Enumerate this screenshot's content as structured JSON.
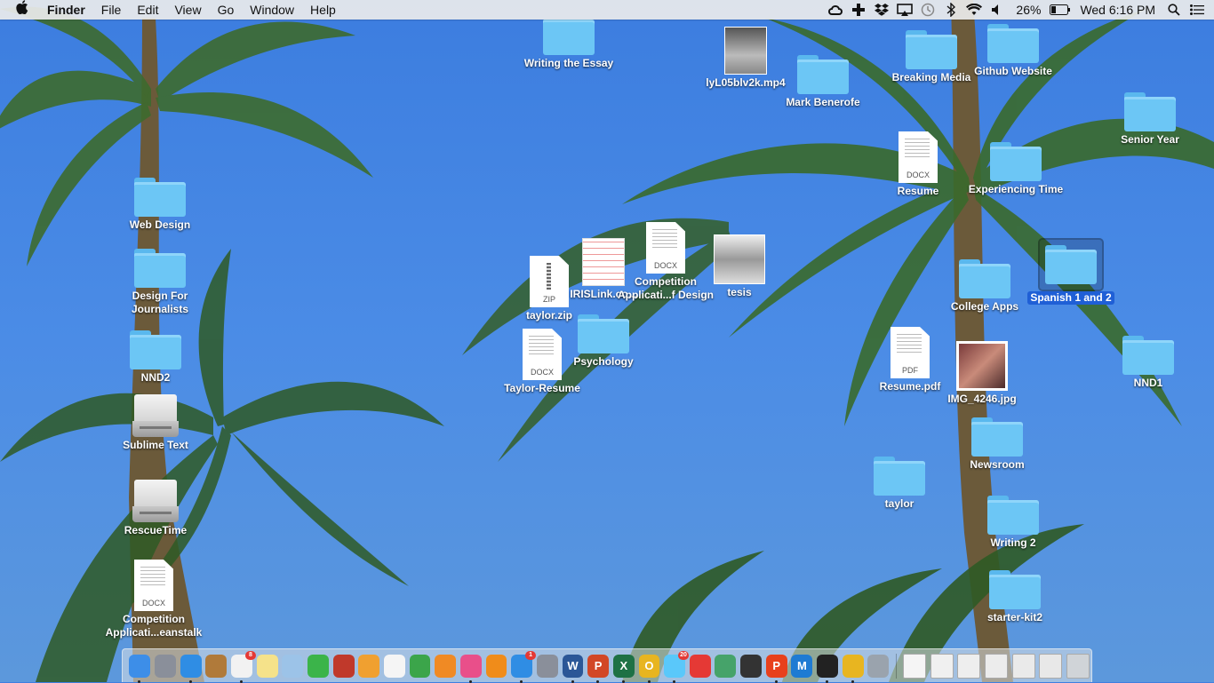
{
  "menubar": {
    "app_name": "Finder",
    "menus": [
      "File",
      "Edit",
      "View",
      "Go",
      "Window",
      "Help"
    ],
    "battery": "26%",
    "clock": "Wed 6:16 PM",
    "status_icons": [
      "creative-cloud-icon",
      "plus-icon",
      "dropbox-icon",
      "airplay-icon",
      "time-machine-icon",
      "bluetooth-icon",
      "wifi-icon",
      "volume-icon",
      "battery-icon",
      "spotlight-icon",
      "notification-center-icon"
    ]
  },
  "desktop": {
    "icons": [
      {
        "label": "Writing the Essay",
        "kind": "folder"
      },
      {
        "label": "lyL05blv2k.mp4",
        "kind": "video"
      },
      {
        "label": "Mark Benerofe",
        "kind": "folder"
      },
      {
        "label": "Breaking Media",
        "kind": "folder"
      },
      {
        "label": "Github Website",
        "kind": "folder"
      },
      {
        "label": "Senior Year",
        "kind": "folder"
      },
      {
        "label": "Resume",
        "kind": "docx",
        "ext": "DOCX"
      },
      {
        "label": "Experiencing Time",
        "kind": "folder"
      },
      {
        "label": "Web Design",
        "kind": "folder"
      },
      {
        "label": "Design For Journalists",
        "kind": "folder"
      },
      {
        "label": "NND2",
        "kind": "folder"
      },
      {
        "label": "Sublime Text",
        "kind": "drive"
      },
      {
        "label": "RescueTime",
        "kind": "drive"
      },
      {
        "label": "Competition Applicati...eanstalk",
        "kind": "docx",
        "ext": "DOCX"
      },
      {
        "label": "taylor.zip",
        "kind": "zip",
        "ext": "ZIP"
      },
      {
        "label": "IRISLink.co...",
        "kind": "image"
      },
      {
        "label": "Competition Applicati...f Design",
        "kind": "docx",
        "ext": "DOCX"
      },
      {
        "label": "tesis",
        "kind": "image"
      },
      {
        "label": "Taylor-Resume",
        "kind": "docx",
        "ext": "DOCX"
      },
      {
        "label": "Psychology",
        "kind": "folder"
      },
      {
        "label": "College Apps",
        "kind": "folder"
      },
      {
        "label": "Spanish 1 and 2",
        "kind": "folder",
        "selected": true
      },
      {
        "label": "Resume.pdf",
        "kind": "pdf",
        "ext": "PDF"
      },
      {
        "label": "IMG_4246.jpg",
        "kind": "photo"
      },
      {
        "label": "NND1",
        "kind": "folder"
      },
      {
        "label": "Newsroom",
        "kind": "folder"
      },
      {
        "label": "taylor",
        "kind": "folder"
      },
      {
        "label": "Writing 2",
        "kind": "folder"
      },
      {
        "label": "starter-kit2",
        "kind": "folder"
      }
    ]
  },
  "dock": {
    "apps": [
      {
        "name": "finder-icon",
        "color": "#3d8ee8"
      },
      {
        "name": "launchpad-icon",
        "color": "#8a8f9a"
      },
      {
        "name": "safari-icon",
        "color": "#2f8de4"
      },
      {
        "name": "notefile-icon",
        "color": "#b07a3a"
      },
      {
        "name": "calendar-icon",
        "color": "#f2f2f2",
        "badge": "8"
      },
      {
        "name": "notes-icon",
        "color": "#f5e28a"
      },
      {
        "name": "preview-icon",
        "color": "#9cc3e8"
      },
      {
        "name": "facetime-icon",
        "color": "#3bb44a"
      },
      {
        "name": "photo-booth-icon",
        "color": "#c0392b"
      },
      {
        "name": "photos-icon",
        "color": "#f0a030"
      },
      {
        "name": "keynote-icon",
        "color": "#f5f5f5"
      },
      {
        "name": "numbers-icon",
        "color": "#3ba54a"
      },
      {
        "name": "pages-icon",
        "color": "#f08a24"
      },
      {
        "name": "itunes-icon",
        "color": "#e94f8a"
      },
      {
        "name": "ibooks-icon",
        "color": "#f08c1a"
      },
      {
        "name": "app-store-icon",
        "color": "#2f8de4",
        "badge": "1"
      },
      {
        "name": "system-preferences-icon",
        "color": "#8a8f9a"
      },
      {
        "name": "word-icon",
        "color": "#2b5797",
        "letter": "W"
      },
      {
        "name": "powerpoint-icon",
        "color": "#d24726",
        "letter": "P"
      },
      {
        "name": "excel-icon",
        "color": "#1e7145",
        "letter": "X"
      },
      {
        "name": "outlook-icon",
        "color": "#e8b520",
        "letter": "O"
      },
      {
        "name": "messages-icon",
        "color": "#5ac8fa",
        "badge": "20"
      },
      {
        "name": "first-aid-icon",
        "color": "#e53935"
      },
      {
        "name": "globe-icon",
        "color": "#46a36a"
      },
      {
        "name": "terminal-icon",
        "color": "#333333"
      },
      {
        "name": "pdf-expert-icon",
        "color": "#e8401c",
        "letter": "P"
      },
      {
        "name": "malwarebytes-icon",
        "color": "#1e7bd3",
        "letter": "M"
      },
      {
        "name": "window-manager-icon",
        "color": "#222222"
      },
      {
        "name": "chrome-icon",
        "color": "#e8b520"
      },
      {
        "name": "image-capture-icon",
        "color": "#9aa3ad"
      }
    ],
    "stacks": [
      {
        "name": "document-stack-icon",
        "color": "#f5f5f5"
      },
      {
        "name": "document-stack-icon",
        "color": "#f0f0f0"
      },
      {
        "name": "document-stack-icon",
        "color": "#eeeeee"
      },
      {
        "name": "document-stack-icon",
        "color": "#ececec"
      },
      {
        "name": "document-stack-icon",
        "color": "#eaeaea"
      },
      {
        "name": "document-stack-icon",
        "color": "#e8e8e8"
      },
      {
        "name": "trash-icon",
        "color": "#d0d4d8"
      }
    ]
  }
}
